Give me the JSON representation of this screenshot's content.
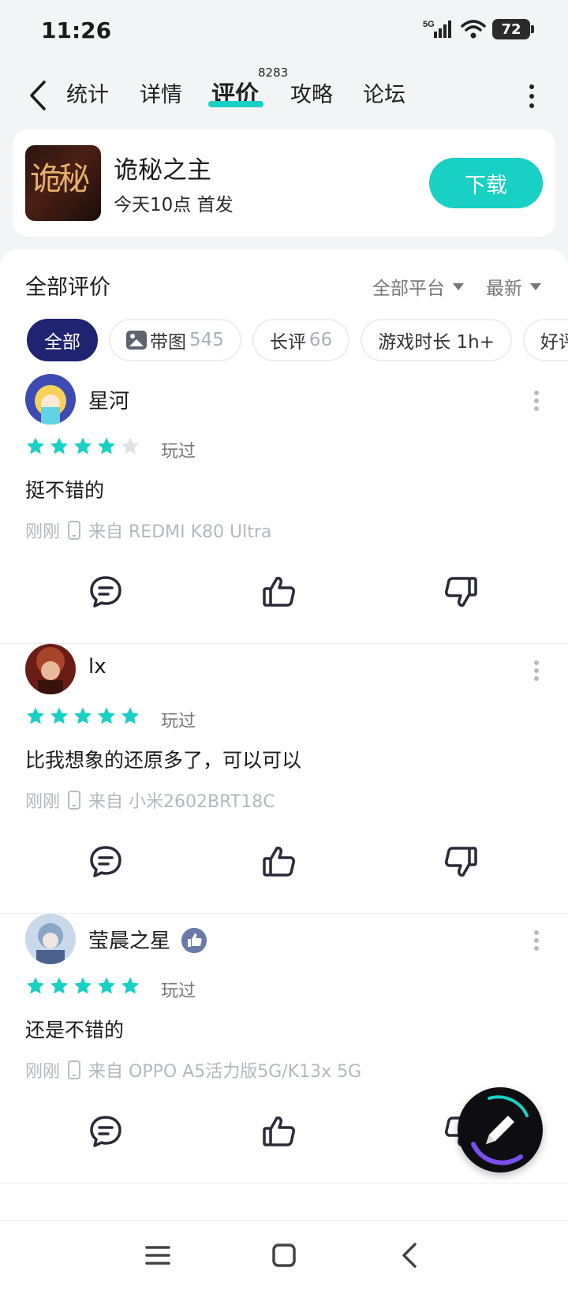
{
  "status": {
    "time": "11:26",
    "network": "5G",
    "battery": "72"
  },
  "nav": {
    "tabs": [
      {
        "label": "统计"
      },
      {
        "label": "详情"
      },
      {
        "label": "评价",
        "badge": "8283",
        "active": true
      },
      {
        "label": "攻略"
      },
      {
        "label": "论坛"
      }
    ]
  },
  "game": {
    "title": "诡秘之主",
    "subtitle": "今天10点 首发",
    "download_label": "下载",
    "icon_text": "诡秘"
  },
  "reviews": {
    "title": "全部评价",
    "platform_filter": "全部平台",
    "sort": "最新",
    "filters": [
      {
        "label": "全部",
        "count": "",
        "active": true
      },
      {
        "label": "带图",
        "count": "545"
      },
      {
        "label": "长评",
        "count": "66"
      },
      {
        "label": "游戏时长 1h+",
        "count": ""
      },
      {
        "label": "好评",
        "count": ""
      }
    ],
    "items": [
      {
        "user": "星河",
        "stars": 4,
        "tag": "玩过",
        "text": "挺不错的",
        "time": "刚刚",
        "device": "来自 REDMI K80 Ultra"
      },
      {
        "user": "lx",
        "stars": 5,
        "tag": "玩过",
        "text": "比我想象的还原多了，可以可以",
        "time": "刚刚",
        "device": "来自 小米2602BRT18C"
      },
      {
        "user": "莹晨之星",
        "stars": 5,
        "tag": "玩过",
        "text": "还是不错的",
        "time": "刚刚",
        "device": "来自 OPPO A5活力版5G/K13x 5G",
        "verified": true
      }
    ]
  },
  "colors": {
    "accent": "#18d0c3",
    "chip_active": "#1f2370",
    "star": "#18d0c3",
    "star_empty": "#dfe3e8"
  }
}
